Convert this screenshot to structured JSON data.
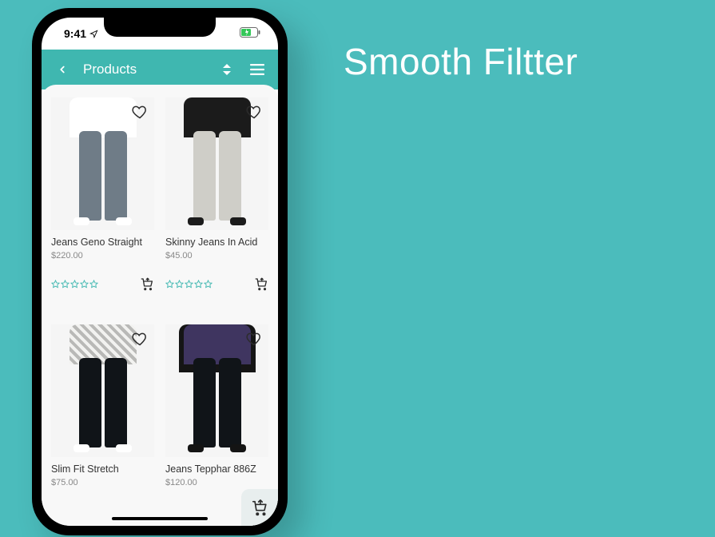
{
  "headline": "Smooth Filtter",
  "statusbar": {
    "time": "9:41"
  },
  "topbar": {
    "title": "Products"
  },
  "colors": {
    "accent": "#3fb7b0",
    "star": "#3fb7b0"
  },
  "products": [
    {
      "name": "Jeans Geno Straight",
      "price": "$220.00",
      "rating": 0,
      "fig": {
        "bg": "#f5f5f5",
        "shirt": "#ffffff",
        "pant": "#6f7c87",
        "shoe": "#ffffff"
      }
    },
    {
      "name": "Skinny Jeans In Acid",
      "price": "$45.00",
      "rating": 0,
      "fig": {
        "bg": "#f5f5f5",
        "shirt": "#1b1b1b",
        "pant": "#cfcec8",
        "shoe": "#1b1b1b"
      }
    },
    {
      "name": "Slim Fit Stretch",
      "price": "$75.00",
      "rating": 0,
      "fig": {
        "bg": "#f5f5f5",
        "shirt": "#e2e2e0",
        "pant": "#101418",
        "shoe": "#ffffff",
        "stripe": true
      }
    },
    {
      "name": "Jeans Tepphar 886Z",
      "price": "$120.00",
      "rating": 0,
      "fig": {
        "bg": "#f5f5f5",
        "shirt": "#3f3560",
        "pant": "#101418",
        "shoe": "#141414",
        "jacket": "#151515"
      }
    }
  ]
}
